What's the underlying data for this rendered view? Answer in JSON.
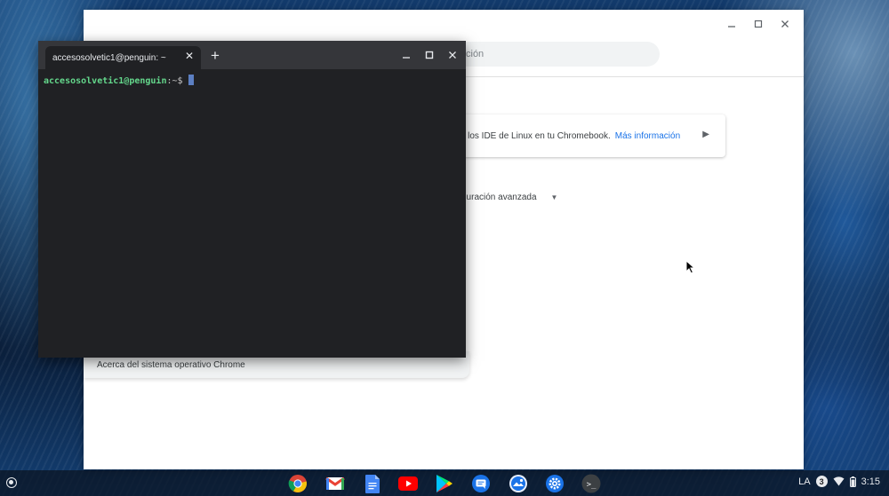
{
  "settings_window": {
    "search_placeholder_fragment": "ción",
    "linux_card_text": "o y los IDE de Linux en tu Chromebook.",
    "linux_card_link": "Más información",
    "advanced_label": "guración avanzada",
    "about_label": "Acerca del sistema operativo Chrome"
  },
  "terminal": {
    "tab_title": "accesosolvetic1@penguin: ~",
    "prompt_user": "accesosolvetic1@penguin",
    "prompt_path": ":~$"
  },
  "shelf": {
    "apps": [
      "chrome-icon",
      "gmail-icon",
      "docs-icon",
      "youtube-icon",
      "play-store-icon",
      "messages-icon",
      "photo-app-icon",
      "settings-icon",
      "terminal-icon"
    ],
    "terminal_glyph": ">_",
    "status": {
      "keyboard_layout": "LA",
      "notification_count": "3",
      "time": "3:15"
    }
  },
  "colors": {
    "terminal_bg": "#202124",
    "terminal_titlebar": "#35363a",
    "prompt_user": "#64d88c",
    "link": "#1a73e8"
  }
}
